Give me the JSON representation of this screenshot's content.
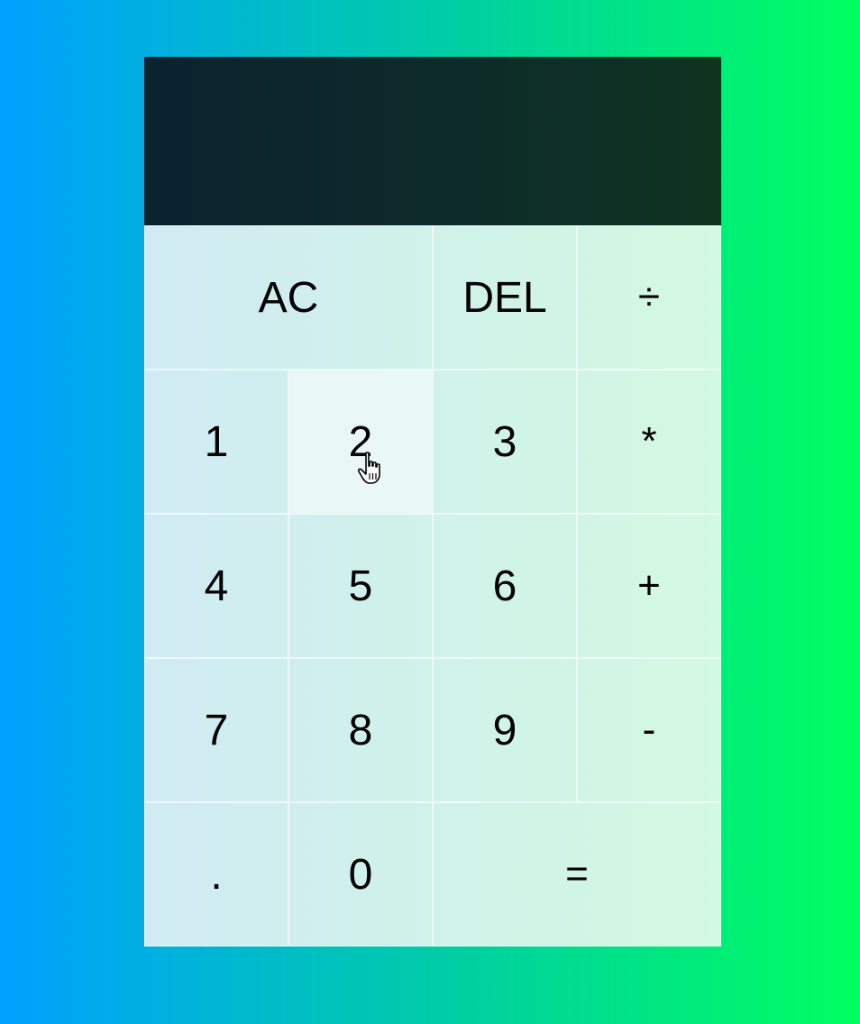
{
  "display": {
    "previous_operand": "",
    "current_operand": ""
  },
  "buttons": {
    "all_clear": "AC",
    "delete": "DEL",
    "divide": "÷",
    "one": "1",
    "two": "2",
    "three": "3",
    "multiply": "*",
    "four": "4",
    "five": "5",
    "six": "6",
    "add": "+",
    "seven": "7",
    "eight": "8",
    "nine": "9",
    "subtract": "-",
    "decimal": ".",
    "zero": "0",
    "equals": "="
  },
  "state": {
    "hovered_button": "two",
    "cursor": "hand-pointer-icon"
  },
  "colors": {
    "background_start": "#00a0ff",
    "background_end": "#00ff60",
    "display_background": "#0d2a2a",
    "keypad_background": "#c8f0e6",
    "text": "#000000"
  }
}
